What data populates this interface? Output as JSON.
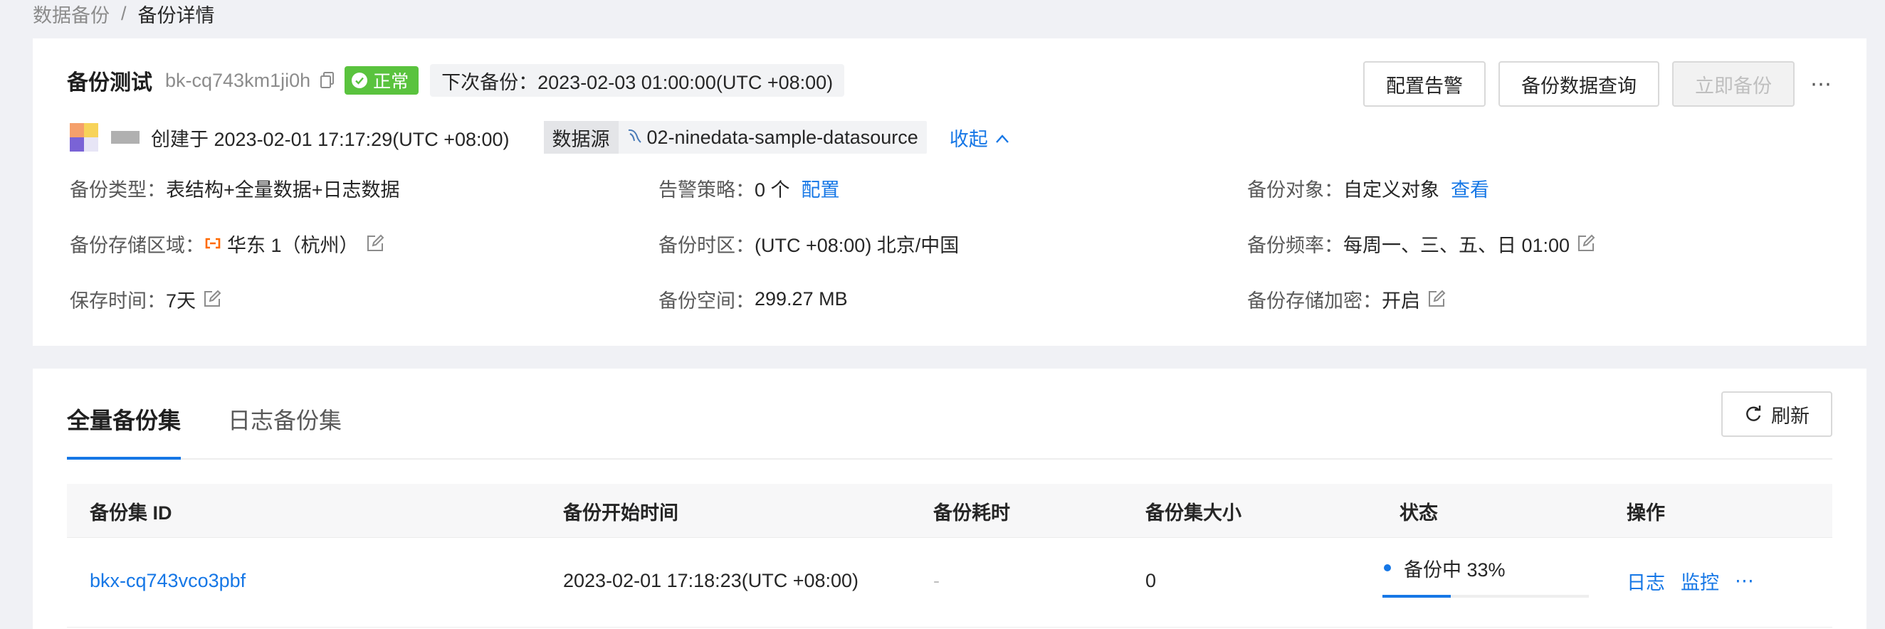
{
  "breadcrumb": {
    "parent": "数据备份",
    "separator": "/",
    "current": "备份详情"
  },
  "task": {
    "name": "备份测试",
    "id": "bk-cq743km1ji0h",
    "status": "正常",
    "next_backup": "下次备份：2023-02-03 01:00:00(UTC +08:00)",
    "created": "创建于 2023-02-01 17:17:29(UTC +08:00)",
    "datasource_label": "数据源",
    "datasource_value": "02-ninedata-sample-datasource",
    "collapse_label": "收起"
  },
  "actions": {
    "config_alert": "配置告警",
    "query_data": "备份数据查询",
    "backup_now": "立即备份",
    "more": "⋯"
  },
  "info": {
    "backup_type_label": "备份类型：",
    "backup_type_value": "表结构+全量数据+日志数据",
    "alert_policy_label": "告警策略：",
    "alert_policy_value": "0 个",
    "alert_policy_link": "配置",
    "backup_object_label": "备份对象：",
    "backup_object_value": "自定义对象",
    "backup_object_link": "查看",
    "storage_region_label": "备份存储区域：",
    "storage_region_value": "华东 1（杭州）",
    "timezone_label": "备份时区：",
    "timezone_value": "(UTC +08:00) 北京/中国",
    "frequency_label": "备份频率：",
    "frequency_value": "每周一、三、五、日 01:00",
    "retention_label": "保存时间：",
    "retention_value": "7天",
    "space_label": "备份空间：",
    "space_value": "299.27 MB",
    "encryption_label": "备份存储加密：",
    "encryption_value": "开启"
  },
  "tabs": {
    "full": "全量备份集",
    "log": "日志备份集",
    "refresh": "刷新"
  },
  "table": {
    "headers": {
      "id": "备份集 ID",
      "start": "备份开始时间",
      "duration": "备份耗时",
      "size": "备份集大小",
      "status": "状态",
      "ops": "操作"
    },
    "rows": [
      {
        "id": "bkx-cq743vco3pbf",
        "start": "2023-02-01 17:18:23(UTC +08:00)",
        "duration": "-",
        "size": "0",
        "status": "备份中 33%",
        "progress": 0.33,
        "op_log": "日志",
        "op_monitor": "监控",
        "op_more": "⋯"
      }
    ]
  },
  "colors": {
    "accent": "#1677e6",
    "success": "#5ac33e",
    "region_icon": "#ff6a00"
  }
}
